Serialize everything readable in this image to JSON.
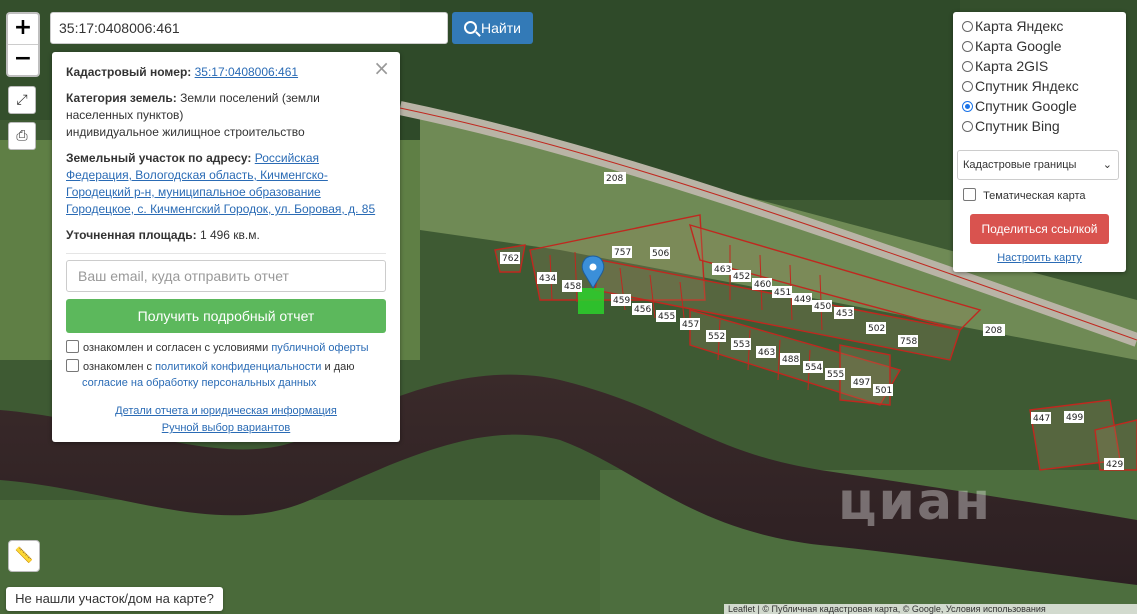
{
  "search": {
    "value": "35:17:0408006:461",
    "button_label": "Найти"
  },
  "zoom": {
    "in": "+",
    "out": "−"
  },
  "info": {
    "cadastral_label": "Кадастровый номер:",
    "cadastral_value": "35:17:0408006:461",
    "category_label": "Категория земель:",
    "category_value": "Земли поселений (земли населенных пунктов)",
    "usage": "индивидуальное жилищное строительство",
    "address_label": "Земельный участок по адресу:",
    "address_value": "Российская Федерация, Вологодская область, Кичменгско-Городецкий р-н, муниципальное образование Городецкое, с. Кичменгский Городок, ул. Боровая, д. 85",
    "area_label": "Уточненная площадь:",
    "area_value": "1 496 кв.м.",
    "email_placeholder": "Ваш email, куда отправить отчет",
    "report_button": "Получить подробный отчет",
    "check1_prefix": "ознакомлен и согласен с условиями",
    "check1_link": "публичной оферты",
    "check2_prefix": "ознакомлен с",
    "check2_link": "политикой конфиденциальности",
    "check2_mid": "и даю",
    "check2_link2": "согласие на обработку персональных данных",
    "details_link": "Детали отчета и юридическая информация",
    "manual_link": "Ручной выбор вариантов"
  },
  "layers": {
    "options": [
      "Карта Яндекс",
      "Карта Google",
      "Карта 2GIS",
      "Спутник Яндекс",
      "Спутник Google",
      "Спутник Bing"
    ],
    "selected": "Спутник Google",
    "select_value": "Кадастровые границы",
    "thematic_label": "Тематическая карта",
    "share_button": "Поделиться ссылкой",
    "setup_link": "Настроить карту"
  },
  "map_labels": {
    "road": "208",
    "parcels": [
      "762",
      "757",
      "506",
      "434",
      "458",
      "459",
      "456",
      "455",
      "457",
      "463",
      "452",
      "460",
      "451",
      "449",
      "450",
      "453",
      "552",
      "553",
      "463",
      "488",
      "554",
      "555",
      "502",
      "758",
      "497",
      "501",
      "447",
      "499",
      "429"
    ]
  },
  "bottom": {
    "not_found": "Не нашли участок/дом на карте?",
    "attribution": "Leaflet | © Публичная кадастровая карта, © Google, Условия использования",
    "watermark": "циан"
  },
  "colors": {
    "search_btn": "#337ab7",
    "report_btn": "#5cb85c",
    "share_btn": "#d9534f",
    "parcel_line": "#c0281f",
    "link": "#2a6bb5"
  }
}
